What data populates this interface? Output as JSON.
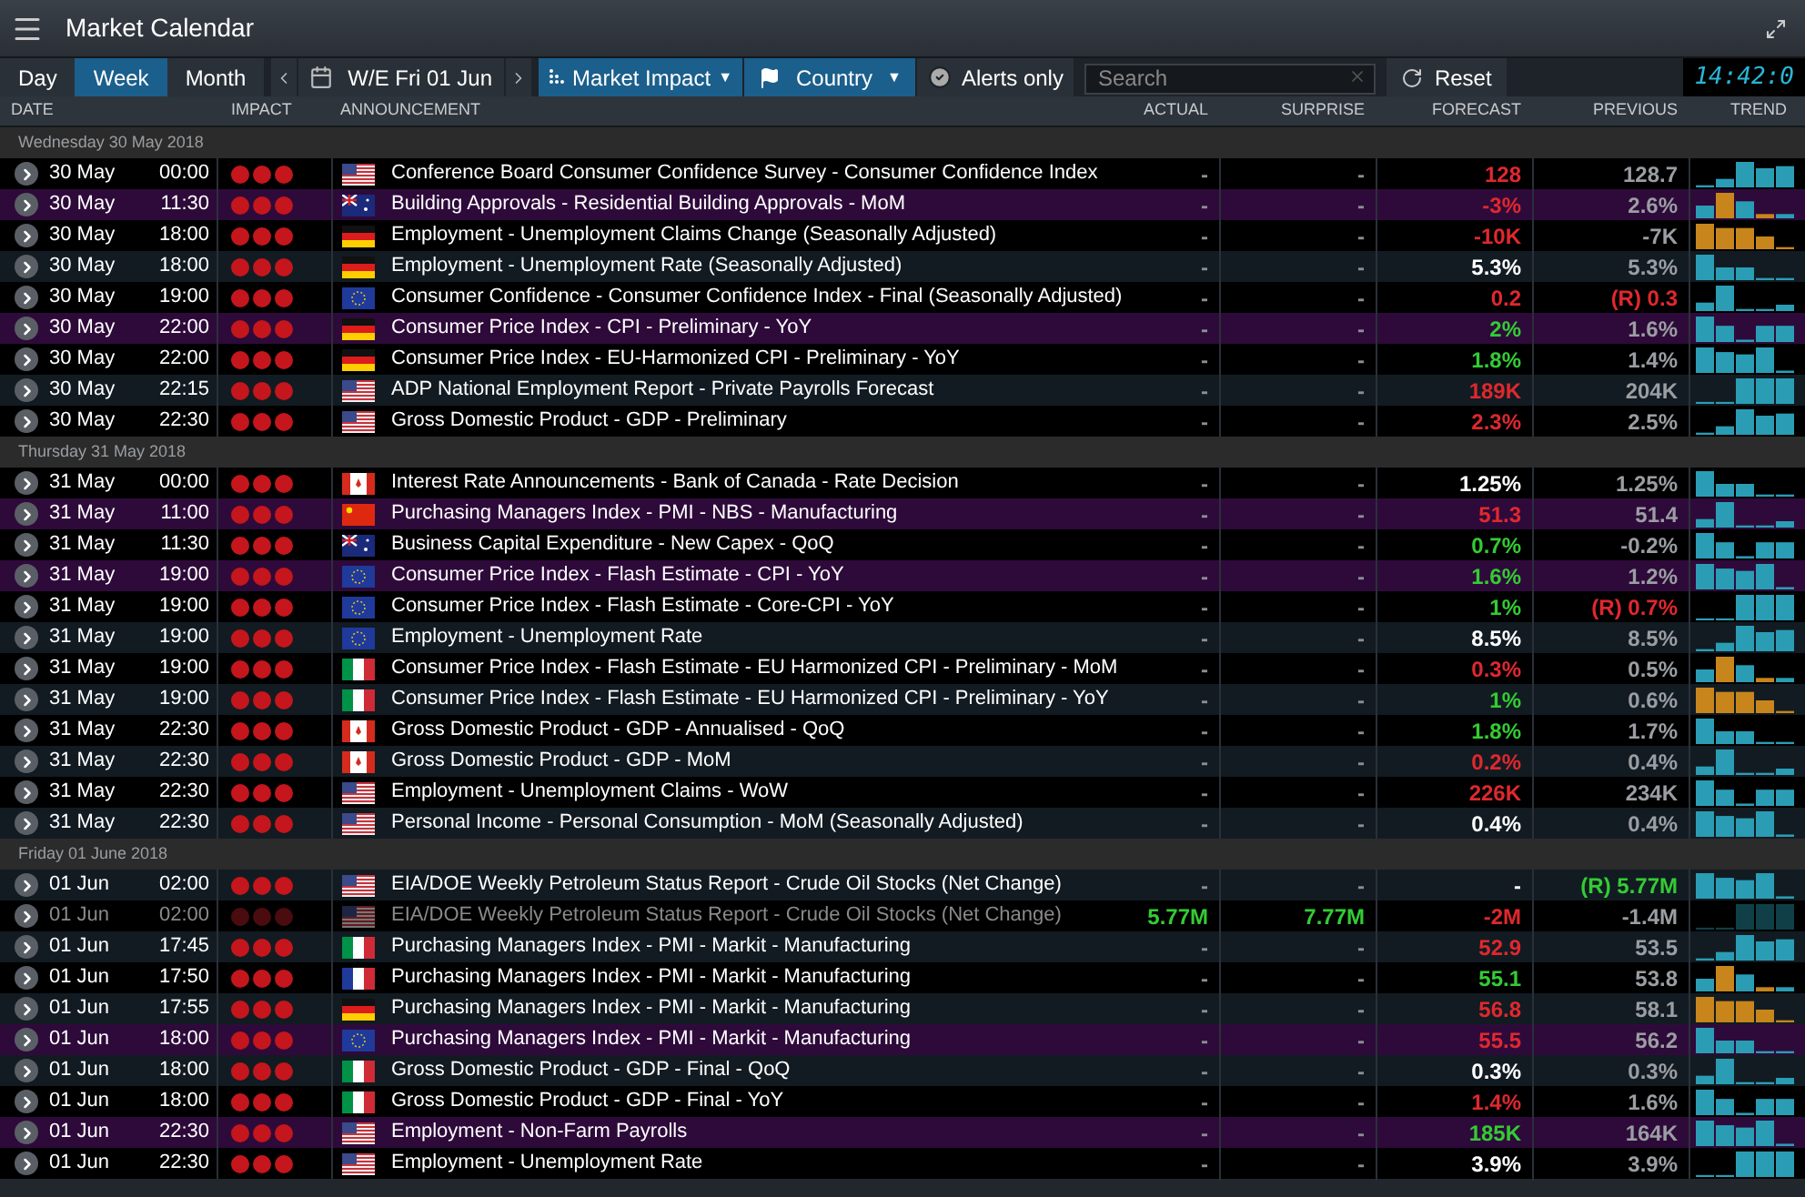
{
  "window": {
    "title": "Market Calendar"
  },
  "toolbar": {
    "periods": [
      {
        "label": "Day",
        "selected": false
      },
      {
        "label": "Week",
        "selected": true
      },
      {
        "label": "Month",
        "selected": false
      }
    ],
    "week_label": "W/E Fri 01 Jun",
    "impact_filter": "Market Impact",
    "impact_caret": "▼",
    "country_filter": "Country",
    "country_caret": "▼",
    "alerts_only": {
      "label": "Alerts only",
      "checked": false
    },
    "search": {
      "placeholder": "Search"
    },
    "reset": "Reset",
    "clock": "14:42:0"
  },
  "columns": [
    "DATE",
    "IMPACT",
    "ANNOUNCEMENT",
    "ACTUAL",
    "SURPRISE",
    "FORECAST",
    "PREVIOUS",
    "TREND"
  ],
  "groups": [
    {
      "title": "Wednesday 30 May 2018",
      "rows": [
        {
          "date": "30 May",
          "time": "00:00",
          "flag": {
            "kind": "us"
          },
          "announcement": "Conference Board Consumer Confidence Survey - Consumer Confidence Index",
          "actual": {
            "text": "-",
            "positive": false,
            "negative": false
          },
          "surprise": {
            "text": "-",
            "positive": false,
            "negative": false
          },
          "forecast": {
            "text": "128",
            "positive": false,
            "negative": true
          },
          "previous": {
            "text": "128.7",
            "positive": false,
            "negative": false
          },
          "highlighted": false,
          "shaded": false,
          "dimmed": false
        },
        {
          "date": "30 May",
          "time": "11:30",
          "flag": {
            "kind": "au"
          },
          "announcement": "Building Approvals - Residential Building Approvals - MoM",
          "actual": {
            "text": "-",
            "positive": false,
            "negative": false
          },
          "surprise": {
            "text": "-",
            "positive": false,
            "negative": false
          },
          "forecast": {
            "text": "-3%",
            "positive": false,
            "negative": true
          },
          "previous": {
            "text": "2.6%",
            "positive": false,
            "negative": false
          },
          "highlighted": true,
          "shaded": false,
          "dimmed": false
        },
        {
          "date": "30 May",
          "time": "18:00",
          "flag": {
            "kind": "de"
          },
          "announcement": "Employment - Unemployment Claims Change (Seasonally Adjusted)",
          "actual": {
            "text": "-",
            "positive": false,
            "negative": false
          },
          "surprise": {
            "text": "-",
            "positive": false,
            "negative": false
          },
          "forecast": {
            "text": "-10K",
            "positive": false,
            "negative": true
          },
          "previous": {
            "text": "-7K",
            "positive": false,
            "negative": false
          },
          "highlighted": false,
          "shaded": false,
          "dimmed": false
        },
        {
          "date": "30 May",
          "time": "18:00",
          "flag": {
            "kind": "de"
          },
          "announcement": "Employment - Unemployment Rate (Seasonally Adjusted)",
          "actual": {
            "text": "-",
            "positive": false,
            "negative": false
          },
          "surprise": {
            "text": "-",
            "positive": false,
            "negative": false
          },
          "forecast": {
            "text": "5.3%",
            "positive": false,
            "negative": false
          },
          "previous": {
            "text": "5.3%",
            "positive": false,
            "negative": false
          },
          "highlighted": false,
          "shaded": true,
          "dimmed": false
        },
        {
          "date": "30 May",
          "time": "19:00",
          "flag": {
            "kind": "eu"
          },
          "announcement": "Consumer Confidence - Consumer Confidence Index - Final (Seasonally Adjusted)",
          "actual": {
            "text": "-",
            "positive": false,
            "negative": false
          },
          "surprise": {
            "text": "-",
            "positive": false,
            "negative": false
          },
          "forecast": {
            "text": "0.2",
            "positive": false,
            "negative": true
          },
          "previous": {
            "text": "(R) 0.3",
            "positive": false,
            "negative": true
          },
          "highlighted": false,
          "shaded": false,
          "dimmed": false
        },
        {
          "date": "30 May",
          "time": "22:00",
          "flag": {
            "kind": "de"
          },
          "announcement": "Consumer Price Index - CPI - Preliminary - YoY",
          "actual": {
            "text": "-",
            "positive": false,
            "negative": false
          },
          "surprise": {
            "text": "-",
            "positive": false,
            "negative": false
          },
          "forecast": {
            "text": "2%",
            "positive": true,
            "negative": false
          },
          "previous": {
            "text": "1.6%",
            "positive": false,
            "negative": false
          },
          "highlighted": true,
          "shaded": false,
          "dimmed": false
        },
        {
          "date": "30 May",
          "time": "22:00",
          "flag": {
            "kind": "de"
          },
          "announcement": "Consumer Price Index - EU-Harmonized CPI - Preliminary - YoY",
          "actual": {
            "text": "-",
            "positive": false,
            "negative": false
          },
          "surprise": {
            "text": "-",
            "positive": false,
            "negative": false
          },
          "forecast": {
            "text": "1.8%",
            "positive": true,
            "negative": false
          },
          "previous": {
            "text": "1.4%",
            "positive": false,
            "negative": false
          },
          "highlighted": false,
          "shaded": false,
          "dimmed": false
        },
        {
          "date": "30 May",
          "time": "22:15",
          "flag": {
            "kind": "us"
          },
          "announcement": "ADP National Employment Report - Private Payrolls Forecast",
          "actual": {
            "text": "-",
            "positive": false,
            "negative": false
          },
          "surprise": {
            "text": "-",
            "positive": false,
            "negative": false
          },
          "forecast": {
            "text": "189K",
            "positive": false,
            "negative": true
          },
          "previous": {
            "text": "204K",
            "positive": false,
            "negative": false
          },
          "highlighted": false,
          "shaded": true,
          "dimmed": false
        },
        {
          "date": "30 May",
          "time": "22:30",
          "flag": {
            "kind": "us"
          },
          "announcement": "Gross Domestic Product - GDP - Preliminary",
          "actual": {
            "text": "-",
            "positive": false,
            "negative": false
          },
          "surprise": {
            "text": "-",
            "positive": false,
            "negative": false
          },
          "forecast": {
            "text": "2.3%",
            "positive": false,
            "negative": true
          },
          "previous": {
            "text": "2.5%",
            "positive": false,
            "negative": false
          },
          "highlighted": false,
          "shaded": false,
          "dimmed": false
        }
      ]
    },
    {
      "title": "Thursday 31 May 2018",
      "rows": [
        {
          "date": "31 May",
          "time": "00:00",
          "flag": {
            "kind": "ca"
          },
          "announcement": "Interest Rate Announcements - Bank of Canada - Rate Decision",
          "actual": {
            "text": "-",
            "positive": false,
            "negative": false
          },
          "surprise": {
            "text": "-",
            "positive": false,
            "negative": false
          },
          "forecast": {
            "text": "1.25%",
            "positive": false,
            "negative": false
          },
          "previous": {
            "text": "1.25%",
            "positive": false,
            "negative": false
          },
          "highlighted": false,
          "shaded": false,
          "dimmed": false
        },
        {
          "date": "31 May",
          "time": "11:00",
          "flag": {
            "kind": "cn"
          },
          "announcement": "Purchasing Managers Index - PMI - NBS - Manufacturing",
          "actual": {
            "text": "-",
            "positive": false,
            "negative": false
          },
          "surprise": {
            "text": "-",
            "positive": false,
            "negative": false
          },
          "forecast": {
            "text": "51.3",
            "positive": false,
            "negative": true
          },
          "previous": {
            "text": "51.4",
            "positive": false,
            "negative": false
          },
          "highlighted": true,
          "shaded": false,
          "dimmed": false
        },
        {
          "date": "31 May",
          "time": "11:30",
          "flag": {
            "kind": "au"
          },
          "announcement": "Business Capital Expenditure - New Capex - QoQ",
          "actual": {
            "text": "-",
            "positive": false,
            "negative": false
          },
          "surprise": {
            "text": "-",
            "positive": false,
            "negative": false
          },
          "forecast": {
            "text": "0.7%",
            "positive": true,
            "negative": false
          },
          "previous": {
            "text": "-0.2%",
            "positive": false,
            "negative": false
          },
          "highlighted": false,
          "shaded": false,
          "dimmed": false
        },
        {
          "date": "31 May",
          "time": "19:00",
          "flag": {
            "kind": "eu"
          },
          "announcement": "Consumer Price Index - Flash Estimate - CPI - YoY",
          "actual": {
            "text": "-",
            "positive": false,
            "negative": false
          },
          "surprise": {
            "text": "-",
            "positive": false,
            "negative": false
          },
          "forecast": {
            "text": "1.6%",
            "positive": true,
            "negative": false
          },
          "previous": {
            "text": "1.2%",
            "positive": false,
            "negative": false
          },
          "highlighted": true,
          "shaded": false,
          "dimmed": false
        },
        {
          "date": "31 May",
          "time": "19:00",
          "flag": {
            "kind": "eu"
          },
          "announcement": "Consumer Price Index - Flash Estimate - Core-CPI - YoY",
          "actual": {
            "text": "-",
            "positive": false,
            "negative": false
          },
          "surprise": {
            "text": "-",
            "positive": false,
            "negative": false
          },
          "forecast": {
            "text": "1%",
            "positive": true,
            "negative": false
          },
          "previous": {
            "text": "(R) 0.7%",
            "positive": false,
            "negative": true
          },
          "highlighted": false,
          "shaded": false,
          "dimmed": false
        },
        {
          "date": "31 May",
          "time": "19:00",
          "flag": {
            "kind": "eu"
          },
          "announcement": "Employment - Unemployment Rate",
          "actual": {
            "text": "-",
            "positive": false,
            "negative": false
          },
          "surprise": {
            "text": "-",
            "positive": false,
            "negative": false
          },
          "forecast": {
            "text": "8.5%",
            "positive": false,
            "negative": false
          },
          "previous": {
            "text": "8.5%",
            "positive": false,
            "negative": false
          },
          "highlighted": false,
          "shaded": true,
          "dimmed": false
        },
        {
          "date": "31 May",
          "time": "19:00",
          "flag": {
            "kind": "it"
          },
          "announcement": "Consumer Price Index - Flash Estimate - EU Harmonized CPI - Preliminary - MoM",
          "actual": {
            "text": "-",
            "positive": false,
            "negative": false
          },
          "surprise": {
            "text": "-",
            "positive": false,
            "negative": false
          },
          "forecast": {
            "text": "0.3%",
            "positive": false,
            "negative": true
          },
          "previous": {
            "text": "0.5%",
            "positive": false,
            "negative": false
          },
          "highlighted": false,
          "shaded": false,
          "dimmed": false
        },
        {
          "date": "31 May",
          "time": "19:00",
          "flag": {
            "kind": "it"
          },
          "announcement": "Consumer Price Index - Flash Estimate - EU Harmonized CPI - Preliminary - YoY",
          "actual": {
            "text": "-",
            "positive": false,
            "negative": false
          },
          "surprise": {
            "text": "-",
            "positive": false,
            "negative": false
          },
          "forecast": {
            "text": "1%",
            "positive": true,
            "negative": false
          },
          "previous": {
            "text": "0.6%",
            "positive": false,
            "negative": false
          },
          "highlighted": false,
          "shaded": true,
          "dimmed": false
        },
        {
          "date": "31 May",
          "time": "22:30",
          "flag": {
            "kind": "ca"
          },
          "announcement": "Gross Domestic Product - GDP - Annualised - QoQ",
          "actual": {
            "text": "-",
            "positive": false,
            "negative": false
          },
          "surprise": {
            "text": "-",
            "positive": false,
            "negative": false
          },
          "forecast": {
            "text": "1.8%",
            "positive": true,
            "negative": false
          },
          "previous": {
            "text": "1.7%",
            "positive": false,
            "negative": false
          },
          "highlighted": false,
          "shaded": false,
          "dimmed": false
        },
        {
          "date": "31 May",
          "time": "22:30",
          "flag": {
            "kind": "ca"
          },
          "announcement": "Gross Domestic Product - GDP - MoM",
          "actual": {
            "text": "-",
            "positive": false,
            "negative": false
          },
          "surprise": {
            "text": "-",
            "positive": false,
            "negative": false
          },
          "forecast": {
            "text": "0.2%",
            "positive": false,
            "negative": true
          },
          "previous": {
            "text": "0.4%",
            "positive": false,
            "negative": false
          },
          "highlighted": false,
          "shaded": true,
          "dimmed": false
        },
        {
          "date": "31 May",
          "time": "22:30",
          "flag": {
            "kind": "us"
          },
          "announcement": "Employment - Unemployment Claims - WoW",
          "actual": {
            "text": "-",
            "positive": false,
            "negative": false
          },
          "surprise": {
            "text": "-",
            "positive": false,
            "negative": false
          },
          "forecast": {
            "text": "226K",
            "positive": false,
            "negative": true
          },
          "previous": {
            "text": "234K",
            "positive": false,
            "negative": false
          },
          "highlighted": false,
          "shaded": false,
          "dimmed": false
        },
        {
          "date": "31 May",
          "time": "22:30",
          "flag": {
            "kind": "us"
          },
          "announcement": "Personal Income - Personal Consumption - MoM (Seasonally Adjusted)",
          "actual": {
            "text": "-",
            "positive": false,
            "negative": false
          },
          "surprise": {
            "text": "-",
            "positive": false,
            "negative": false
          },
          "forecast": {
            "text": "0.4%",
            "positive": false,
            "negative": false
          },
          "previous": {
            "text": "0.4%",
            "positive": false,
            "negative": false
          },
          "highlighted": false,
          "shaded": true,
          "dimmed": false
        }
      ]
    },
    {
      "title": "Friday 01 June 2018",
      "rows": [
        {
          "date": "01 Jun",
          "time": "02:00",
          "flag": {
            "kind": "us"
          },
          "announcement": "EIA/DOE Weekly Petroleum Status Report - Crude Oil Stocks (Net Change)",
          "actual": {
            "text": "-",
            "positive": false,
            "negative": false
          },
          "surprise": {
            "text": "-",
            "positive": false,
            "negative": false
          },
          "forecast": {
            "text": "-",
            "positive": false,
            "negative": false
          },
          "previous": {
            "text": "(R) 5.77M",
            "positive": true,
            "negative": false
          },
          "highlighted": false,
          "shaded": true,
          "dimmed": false
        },
        {
          "date": "01 Jun",
          "time": "02:00",
          "flag": {
            "kind": "us"
          },
          "announcement": "EIA/DOE Weekly Petroleum Status Report - Crude Oil Stocks (Net Change)",
          "actual": {
            "text": "5.77M",
            "positive": true,
            "negative": false
          },
          "surprise": {
            "text": "7.77M",
            "positive": true,
            "negative": false
          },
          "forecast": {
            "text": "-2M",
            "positive": false,
            "negative": true
          },
          "previous": {
            "text": "-1.4M",
            "positive": false,
            "negative": false
          },
          "highlighted": false,
          "shaded": false,
          "dimmed": true
        },
        {
          "date": "01 Jun",
          "time": "17:45",
          "flag": {
            "kind": "it"
          },
          "announcement": "Purchasing Managers Index - PMI - Markit - Manufacturing",
          "actual": {
            "text": "-",
            "positive": false,
            "negative": false
          },
          "surprise": {
            "text": "-",
            "positive": false,
            "negative": false
          },
          "forecast": {
            "text": "52.9",
            "positive": false,
            "negative": true
          },
          "previous": {
            "text": "53.5",
            "positive": false,
            "negative": false
          },
          "highlighted": false,
          "shaded": true,
          "dimmed": false
        },
        {
          "date": "01 Jun",
          "time": "17:50",
          "flag": {
            "kind": "fr"
          },
          "announcement": "Purchasing Managers Index - PMI - Markit - Manufacturing",
          "actual": {
            "text": "-",
            "positive": false,
            "negative": false
          },
          "surprise": {
            "text": "-",
            "positive": false,
            "negative": false
          },
          "forecast": {
            "text": "55.1",
            "positive": true,
            "negative": false
          },
          "previous": {
            "text": "53.8",
            "positive": false,
            "negative": false
          },
          "highlighted": false,
          "shaded": false,
          "dimmed": false
        },
        {
          "date": "01 Jun",
          "time": "17:55",
          "flag": {
            "kind": "de"
          },
          "announcement": "Purchasing Managers Index - PMI - Markit - Manufacturing",
          "actual": {
            "text": "-",
            "positive": false,
            "negative": false
          },
          "surprise": {
            "text": "-",
            "positive": false,
            "negative": false
          },
          "forecast": {
            "text": "56.8",
            "positive": false,
            "negative": true
          },
          "previous": {
            "text": "58.1",
            "positive": false,
            "negative": false
          },
          "highlighted": false,
          "shaded": true,
          "dimmed": false
        },
        {
          "date": "01 Jun",
          "time": "18:00",
          "flag": {
            "kind": "eu"
          },
          "announcement": "Purchasing Managers Index - PMI - Markit - Manufacturing",
          "actual": {
            "text": "-",
            "positive": false,
            "negative": false
          },
          "surprise": {
            "text": "-",
            "positive": false,
            "negative": false
          },
          "forecast": {
            "text": "55.5",
            "positive": false,
            "negative": true
          },
          "previous": {
            "text": "56.2",
            "positive": false,
            "negative": false
          },
          "highlighted": true,
          "shaded": false,
          "dimmed": false
        },
        {
          "date": "01 Jun",
          "time": "18:00",
          "flag": {
            "kind": "it"
          },
          "announcement": "Gross Domestic Product - GDP - Final - QoQ",
          "actual": {
            "text": "-",
            "positive": false,
            "negative": false
          },
          "surprise": {
            "text": "-",
            "positive": false,
            "negative": false
          },
          "forecast": {
            "text": "0.3%",
            "positive": false,
            "negative": false
          },
          "previous": {
            "text": "0.3%",
            "positive": false,
            "negative": false
          },
          "highlighted": false,
          "shaded": true,
          "dimmed": false
        },
        {
          "date": "01 Jun",
          "time": "18:00",
          "flag": {
            "kind": "it"
          },
          "announcement": "Gross Domestic Product - GDP - Final - YoY",
          "actual": {
            "text": "-",
            "positive": false,
            "negative": false
          },
          "surprise": {
            "text": "-",
            "positive": false,
            "negative": false
          },
          "forecast": {
            "text": "1.4%",
            "positive": false,
            "negative": true
          },
          "previous": {
            "text": "1.6%",
            "positive": false,
            "negative": false
          },
          "highlighted": false,
          "shaded": false,
          "dimmed": false
        },
        {
          "date": "01 Jun",
          "time": "22:30",
          "flag": {
            "kind": "us"
          },
          "announcement": "Employment - Non-Farm Payrolls",
          "actual": {
            "text": "-",
            "positive": false,
            "negative": false
          },
          "surprise": {
            "text": "-",
            "positive": false,
            "negative": false
          },
          "forecast": {
            "text": "185K",
            "positive": true,
            "negative": false
          },
          "previous": {
            "text": "164K",
            "positive": false,
            "negative": false
          },
          "highlighted": true,
          "shaded": false,
          "dimmed": false
        },
        {
          "date": "01 Jun",
          "time": "22:30",
          "flag": {
            "kind": "us"
          },
          "announcement": "Employment - Unemployment Rate",
          "actual": {
            "text": "-",
            "positive": false,
            "negative": false
          },
          "surprise": {
            "text": "-",
            "positive": false,
            "negative": false
          },
          "forecast": {
            "text": "3.9%",
            "positive": false,
            "negative": false
          },
          "previous": {
            "text": "3.9%",
            "positive": false,
            "negative": false
          },
          "highlighted": false,
          "shaded": false,
          "dimmed": false
        }
      ]
    }
  ]
}
